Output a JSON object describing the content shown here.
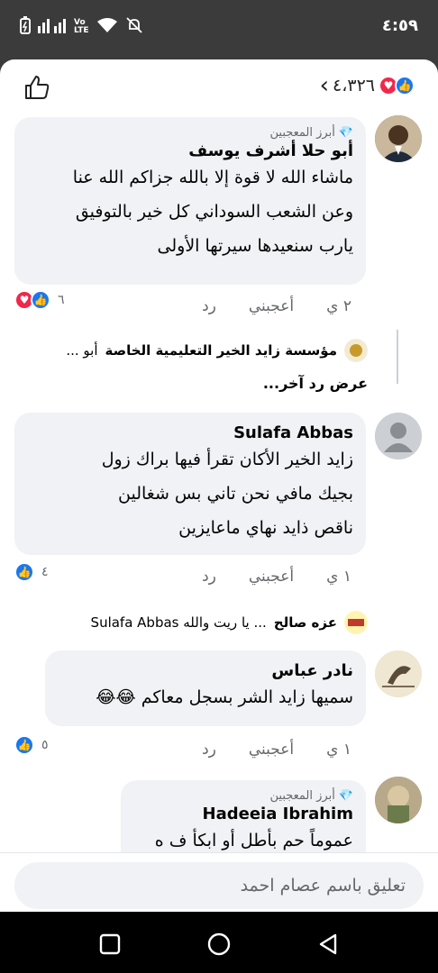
{
  "status_bar": {
    "time": "٤:٥٩"
  },
  "top_bar": {
    "reaction_count": "٤،٣٢٦"
  },
  "comments": [
    {
      "badge": "أبرز المعجبين",
      "author": "أبو حلا أشرف يوسف",
      "text_lines": [
        "ماشاء الله لا قوة إلا بالله جزاكم الله عنا",
        "وعن الشعب السوداني كل خير بالتوفيق",
        "يارب سنعيدها سيرتها الأولى"
      ],
      "time": "٢ ي",
      "like_label": "أعجبني",
      "reply_label": "رد",
      "reaction_count": "٦",
      "reply_preview": {
        "author": "مؤسسة زايد الخير التعليمية الخاصة",
        "text": "أبو ..."
      },
      "more_replies": "عرض رد آخر..."
    },
    {
      "author": "Sulafa Abbas",
      "text_lines": [
        "زايد الخير الأكان تقرأ فيها براك زول",
        "بجيك مافي  نحن  تاني بس  شغالين",
        "ناقص ذايد نهاي ماعايزين"
      ],
      "time": "١ ي",
      "like_label": "أعجبني",
      "reply_label": "رد",
      "reaction_count": "٤",
      "reply_preview": {
        "author": "عزه صالح",
        "text": "... يا ريت والله Sulafa Abbas"
      }
    },
    {
      "author": "نادر عباس",
      "text_lines": [
        "سميها زايد الشر بسجل معاكم 😂😂"
      ],
      "time": "١ ي",
      "like_label": "أعجبني",
      "reply_label": "رد",
      "reaction_count": "٥"
    },
    {
      "badge": "أبرز المعجبين",
      "author": "Hadeeia Ibrahim",
      "text_lines": [
        "عموماً حم بأطل أو ابكأ ف ه"
      ]
    }
  ],
  "composer": {
    "placeholder": "تعليق باسم عصام احمد"
  },
  "colors": {
    "like_blue": "#1877f2",
    "love_red": "#f0284a",
    "bubble": "#f0f2f5"
  }
}
